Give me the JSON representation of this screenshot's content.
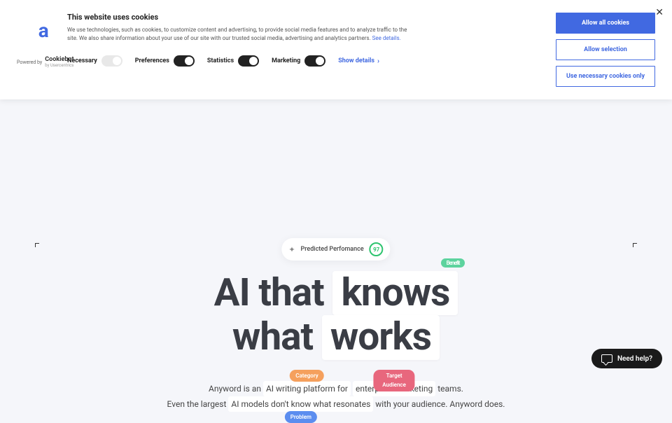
{
  "cookie": {
    "title": "This website uses cookies",
    "description": "We use technologies, such as cookies, to customize content and advertising, to provide social media features and to analyze traffic to the site. We also share information about your use of our site with our trusted social media, advertising and analytics partners. ",
    "see_details": "See details.",
    "toggles": {
      "necessary": "Necessary",
      "preferences": "Preferences",
      "statistics": "Statistics",
      "marketing": "Marketing"
    },
    "show_details": "Show details",
    "buttons": {
      "allow_all": "Allow all cookies",
      "allow_selection": "Allow selection",
      "necessary_only": "Use necessary cookies only"
    },
    "powered_by": "Powered by",
    "cookiebot": "Cookiebot",
    "cookiebot_sub": "by Usercentrics"
  },
  "logo": "a",
  "perf": {
    "label": "Predicted Perfomance",
    "score": "97"
  },
  "headline": {
    "line1_pre": "AI that ",
    "line1_highlight": "knows",
    "line2_pre": "what ",
    "line2_highlight": "works"
  },
  "tags": {
    "benefit": "Benefit",
    "category": "Category",
    "audience": "Target Audience",
    "problem": "Problem"
  },
  "subhead": {
    "l1_pre": "Anyword is an ",
    "l1_h1": "AI writing platform for",
    "l1_mid": " ",
    "l1_h2": "enterprise marketing",
    "l1_post": " teams.",
    "l2_pre": "Even the largest ",
    "l2_h1": "AI models don't know what resonates",
    "l2_post": " with your audience. Anyword does."
  },
  "help": "Need help?"
}
